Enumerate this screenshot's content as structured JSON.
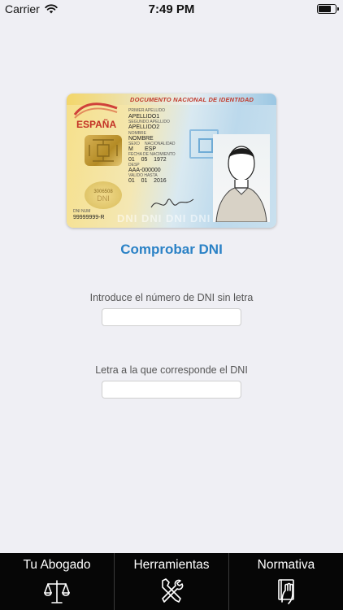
{
  "status_bar": {
    "carrier": "Carrier",
    "time": "7:49 PM",
    "battery_level": 0.75
  },
  "id_card": {
    "header": "DOCUMENTO NACIONAL DE IDENTIDAD",
    "country": "ESPAÑA",
    "fields": {
      "primer_apellido_label": "PRIMER APELLIDO",
      "primer_apellido": "APELLIDO1",
      "segundo_apellido_label": "SEGUNDO APELLIDO",
      "segundo_apellido": "APELLIDO2",
      "nombre_label": "NOMBRE",
      "nombre": "NOMBRE",
      "sexo_label": "SEXO",
      "sexo": "M",
      "nacionalidad_label": "NACIONALIDAD",
      "nacionalidad": "ESP",
      "fecha_nacimiento_label": "FECHA DE NACIMIENTO",
      "fecha_nacimiento": "01    05    1972",
      "desp_label": "DESP",
      "desp": "AAA-000000",
      "valido_hasta_label": "VALIDO HASTA",
      "valido_hasta": "01    01    2016",
      "dni_num_label": "DNI NUM",
      "dni_num": "99999999-R",
      "badge_number": "3006508",
      "badge_text": "DNI",
      "bottom_text": "DNI DNI DNI DNI DNI"
    }
  },
  "main": {
    "title": "Comprobar DNI",
    "dni_field": {
      "label": "Introduce el número de DNI sin letra",
      "value": "",
      "placeholder": ""
    },
    "letter_field": {
      "label": "Letra a la que corresponde el DNI",
      "value": "",
      "placeholder": ""
    }
  },
  "tab_bar": {
    "tabs": [
      {
        "label": "Tu Abogado",
        "icon": "scales-icon"
      },
      {
        "label": "Herramientas",
        "icon": "tools-icon"
      },
      {
        "label": "Normativa",
        "icon": "book-hand-icon"
      }
    ]
  }
}
